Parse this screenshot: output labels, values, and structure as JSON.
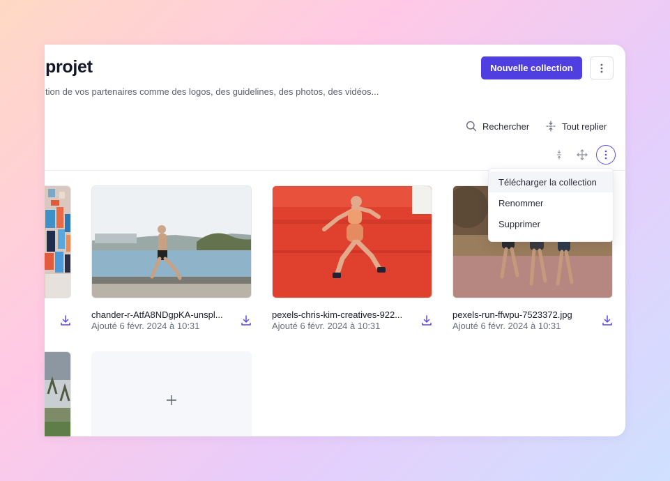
{
  "header": {
    "title": "projet",
    "subtitle": "tion de vos partenaires comme des logos, des guidelines, des photos, des vidéos...",
    "new_collection_label": "Nouvelle collection"
  },
  "toolbar": {
    "search_label": "Rechercher",
    "collapse_all_label": "Tout replier"
  },
  "files": [
    {
      "name": "chander-r-AtfA8NDgpKA-unspl...",
      "date": "Ajouté 6 févr. 2024 à 10:31"
    },
    {
      "name": "pexels-chris-kim-creatives-922...",
      "date": "Ajouté 6 févr. 2024 à 10:31"
    },
    {
      "name": "pexels-run-ffwpu-7523372.jpg",
      "date": "Ajouté 6 févr. 2024 à 10:31"
    }
  ],
  "menu": {
    "items": [
      "Télécharger la collection",
      "Renommer",
      "Supprimer"
    ]
  },
  "colors": {
    "accent": "#4f3fe0",
    "active_ring": "#5b4ae6"
  },
  "icons": {
    "search": "search-icon",
    "collapse": "collapse-icon",
    "move": "move-icon",
    "more": "more-vertical-icon",
    "download": "download-icon",
    "add": "plus-icon"
  }
}
